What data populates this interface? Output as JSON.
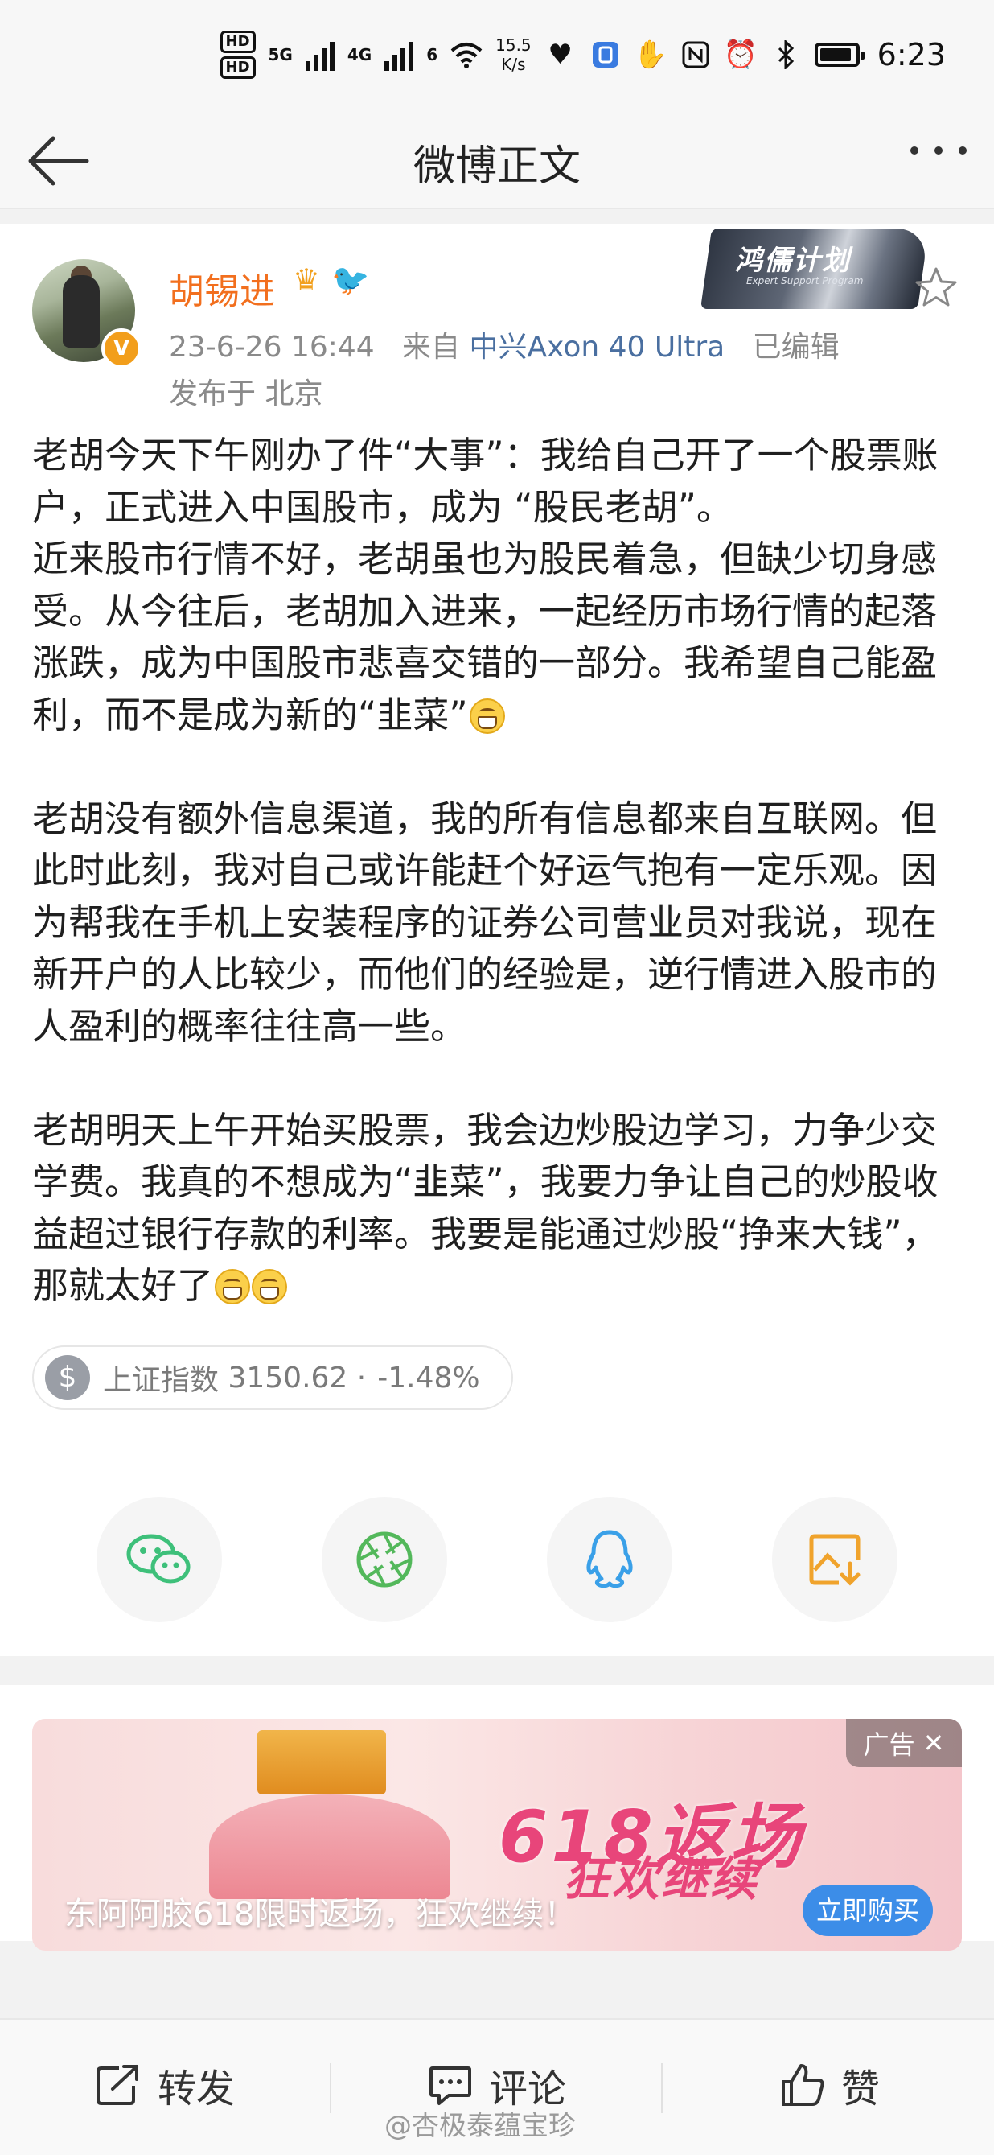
{
  "status_bar": {
    "hd1": "HD",
    "hd2": "HD",
    "net1": "5G",
    "net2": "4G",
    "wifi_num": "6",
    "speed_value": "15.5",
    "speed_unit": "K/s",
    "time": "6:23"
  },
  "nav": {
    "title": "微博正文"
  },
  "post": {
    "username": "胡锡进",
    "timestamp": "23-6-26 16:44",
    "from_label": "来自",
    "source": "中兴Axon 40 Ultra",
    "edited": "已编辑",
    "location": "发布于 北京",
    "banner_title": "鸿儒计划",
    "banner_sub": "Expert Support Program",
    "paragraphs": [
      "老胡今天下午刚办了件“大事”：我给自己开了一个股票账户，正式进入中国股市，成为 “股民老胡”。",
      "近来股市行情不好，老胡虽也为股民着急，但缺少切身感受。从今往后，老胡加入进来，一起经历市场行情的起落涨跌，成为中国股市悲喜交错的一部分。我希望自己能盈利，而不是成为新的“韭菜”",
      "老胡没有额外信息渠道，我的所有信息都来自互联网。但此时此刻，我对自己或许能赶个好运气抱有一定乐观。因为帮我在手机上安装程序的证券公司营业员对我说，现在新开户的人比较少，而他们的经验是，逆行情进入股市的人盈利的概率往往高一些。",
      "老胡明天上午开始买股票，我会边炒股边学习，力争少交学费。我真的不想成为“韭菜”，我要力争让自己的炒股收益超过银行存款的利率。我要是能通过炒股“挣来大钱”，那就太好了"
    ],
    "stock": {
      "name": "上证指数",
      "value": "3150.62",
      "sep": "·",
      "change": "-1.48%",
      "icon_symbol": "$"
    }
  },
  "share": [
    {
      "name": "wechat-icon",
      "color": "#3ec07a"
    },
    {
      "name": "moments-icon",
      "color": "#53b85b"
    },
    {
      "name": "qq-icon",
      "color": "#3aa0e8"
    },
    {
      "name": "save-image-icon",
      "color": "#f0a32c"
    }
  ],
  "ad": {
    "tag": "广告",
    "title": "东阿阿胶618限时返场，狂欢继续！",
    "button": "立即购买",
    "graphic_line1": "618返场",
    "graphic_line2": "狂欢继续"
  },
  "bottom": {
    "repost": "转发",
    "comment": "评论",
    "like": "赞"
  },
  "watermark": "@杏极泰蕴宝珍"
}
